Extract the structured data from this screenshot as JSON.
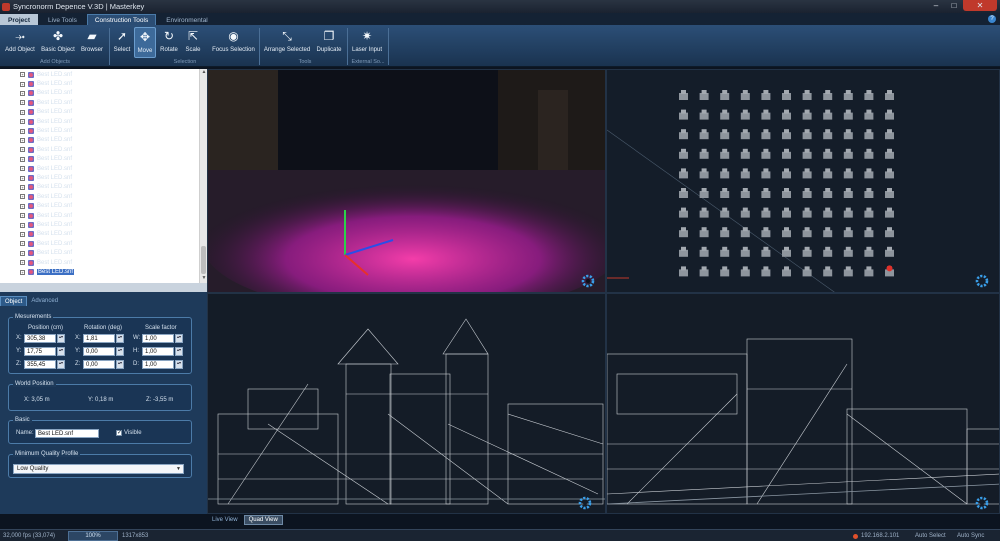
{
  "window": {
    "title": "Syncronorm Depence V.3D | Masterkey"
  },
  "tabs": [
    {
      "label": "Project"
    },
    {
      "label": "Live Tools"
    },
    {
      "label": "Construction Tools"
    },
    {
      "label": "Environmental"
    }
  ],
  "ribbon": {
    "add_objects": {
      "add_object": "Add Object",
      "basic_object": "Basic Object",
      "browser": "Browser",
      "group": "Add Objects"
    },
    "selection": {
      "select": "Select",
      "move": "Move",
      "rotate": "Rotate",
      "scale": "Scale",
      "focus_selection": "Focus Selection",
      "group": "Selection"
    },
    "tools": {
      "arrange_selected": "Arrange Selected",
      "duplicate": "Duplicate",
      "group": "Tools"
    },
    "external": {
      "laser_input": "Laser Input",
      "group": "External So..."
    }
  },
  "tree": {
    "items": [
      "Best LED.snf",
      "Best LED.snf",
      "Best LED.snf",
      "Best LED.snf",
      "Best LED.snf",
      "Best LED.snf",
      "Best LED.snf",
      "Best LED.snf",
      "Best LED.snf",
      "Best LED.snf",
      "Best LED.snf",
      "Best LED.snf",
      "Best LED.snf",
      "Best LED.snf",
      "Best LED.snf",
      "Best LED.snf",
      "Best LED.snf",
      "Best LED.snf",
      "Best LED.snf",
      "Best LED.snf",
      "Best LED.snf",
      "Best LED.snf"
    ],
    "selected_index": 21
  },
  "props": {
    "tabs": {
      "object": "Object",
      "advanced": "Advanced"
    },
    "measurements": {
      "title": "Mesurements",
      "position_header": "Position (cm)",
      "rotation_header": "Rotation (deg)",
      "scale_header": "Scale factor",
      "x_label": "X:",
      "y_label": "Y:",
      "z_label": "Z:",
      "w_label": "W:",
      "h_label": "H:",
      "d_label": "D:",
      "pos_x": "305,38",
      "pos_y": "17,75",
      "pos_z": "355,45",
      "rot_x": "1,81",
      "rot_y": "0,00",
      "rot_z": "0,00",
      "scale_w": "1,00",
      "scale_h": "1,00",
      "scale_d": "1,00"
    },
    "world_position": {
      "title": "World Position",
      "x": "X: 3,05 m",
      "y": "Y: 0,18 m",
      "z": "Z: -3,55 m"
    },
    "basic": {
      "title": "Basic",
      "name_label": "Name:",
      "name_value": "Best LED.snf",
      "visible_label": "Visible",
      "visible_checked": true
    },
    "quality": {
      "title": "Minimum Quality Profile",
      "value": "Low Quality"
    }
  },
  "viewport_tabs": {
    "live_view": "Live View",
    "quad_view": "Quad View"
  },
  "status": {
    "fps": "32,000 fps (33,074)",
    "zoom": "100%",
    "resolution": "1317x853",
    "ip": "192.168.2.101",
    "auto_select": "Auto Select",
    "auto_sync": "Auto Sync"
  },
  "colors": {
    "accent": "#2b4d74",
    "selection": "#3b6fc4",
    "gear": "#3a9ee8",
    "led": "#e83a6a"
  },
  "icons": {
    "add_object": "add-object-icon",
    "basic_object": "basic-object-icon",
    "browser": "folder-icon",
    "select": "cursor-icon",
    "move": "move-icon",
    "rotate": "rotate-icon",
    "scale": "scale-icon",
    "focus": "eye-icon",
    "arrange": "arrange-icon",
    "duplicate": "duplicate-icon",
    "laser": "laser-icon",
    "viewport_settings": "gear-icon"
  }
}
